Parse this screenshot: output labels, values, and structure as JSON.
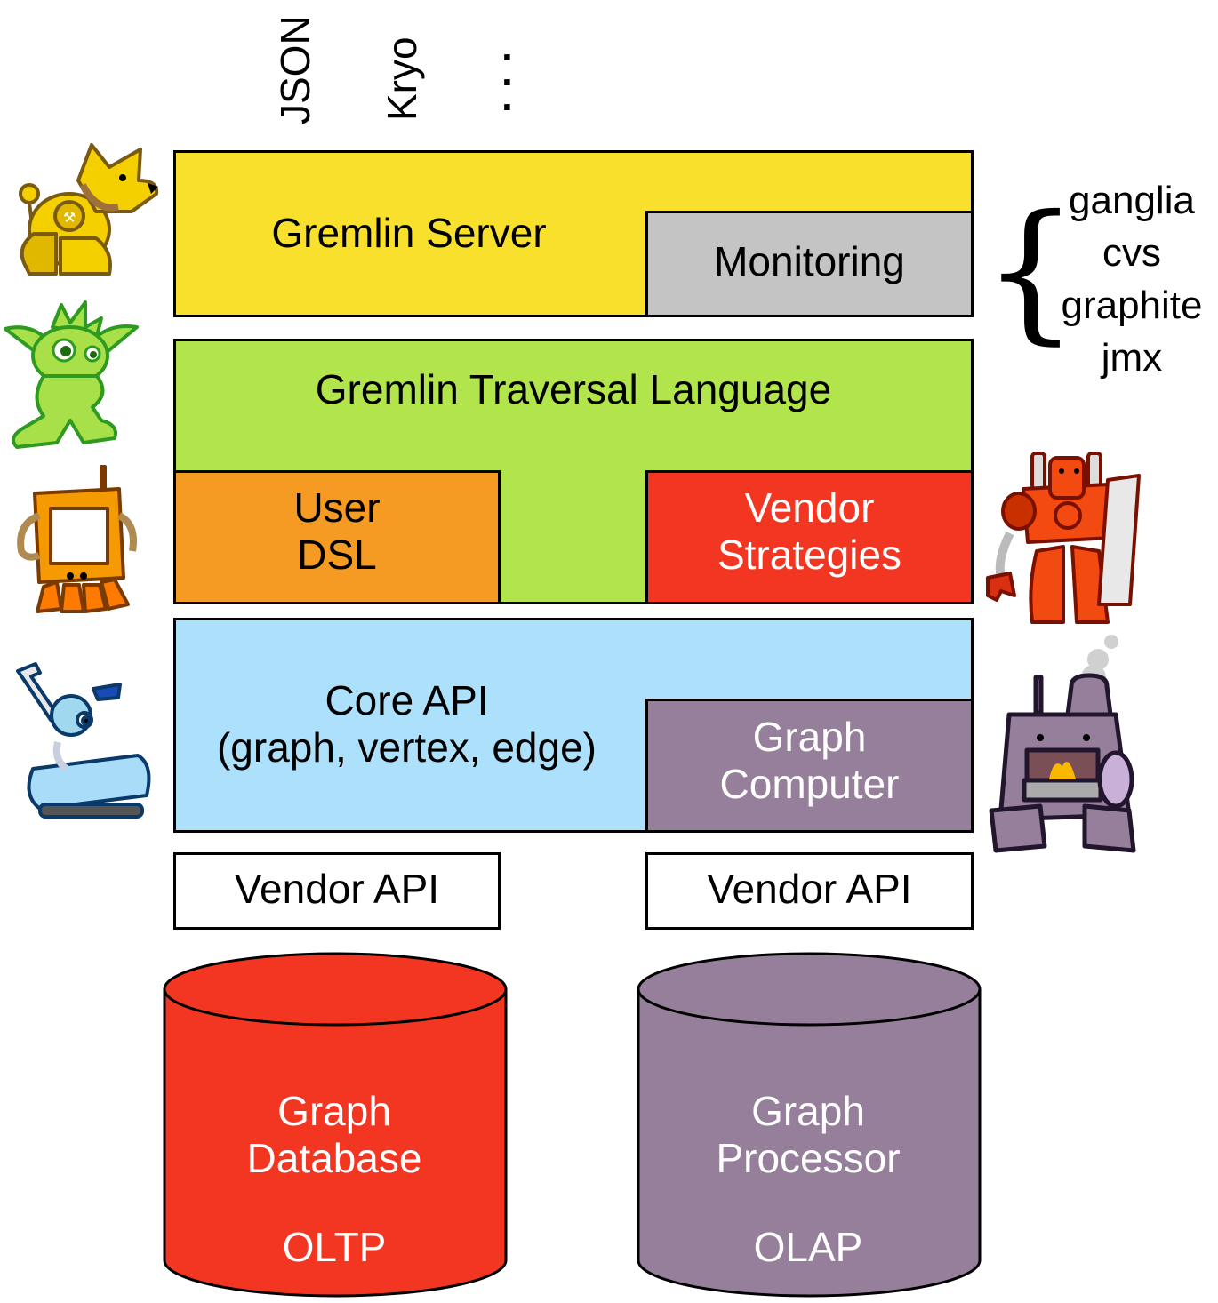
{
  "serialization_formats": [
    "JSON",
    "Kryo",
    "..."
  ],
  "layers": {
    "gremlin_server": {
      "label": "Gremlin Server",
      "color": "#f8e02c"
    },
    "monitoring": {
      "label": "Monitoring",
      "color": "#c4c4c4"
    },
    "traversal_language": {
      "label": "Gremlin Traversal Language",
      "color": "#b2e44b"
    },
    "user_dsl": {
      "line1": "User",
      "line2": "DSL",
      "color": "#f59a23"
    },
    "vendor_strategies": {
      "line1": "Vendor",
      "line2": "Strategies",
      "color": "#f23621"
    },
    "core_api": {
      "line1": "Core API",
      "line2": "(graph, vertex, edge)",
      "color": "#ade0fb"
    },
    "graph_computer": {
      "line1": "Graph",
      "line2": "Computer",
      "color": "#957f9a"
    },
    "vendor_api_left": {
      "label": "Vendor API"
    },
    "vendor_api_right": {
      "label": "Vendor API"
    }
  },
  "databases": {
    "graph_database": {
      "line1": "Graph",
      "line2": "Database",
      "type": "OLTP",
      "color": "#f23621"
    },
    "graph_processor": {
      "line1": "Graph",
      "line2": "Processor",
      "type": "OLAP",
      "color": "#957f9a"
    }
  },
  "monitoring_tools": [
    "ganglia",
    "cvs",
    "graphite",
    "jmx"
  ],
  "mascots": {
    "dog": "yellow-robot-dog-mascot",
    "gremlin": "green-gremlin-mascot",
    "frame": "orange-frame-robot-mascot",
    "tank": "blue-tank-robot-mascot",
    "red_robot": "red-robot-mascot",
    "furnace": "purple-furnace-mascot"
  }
}
